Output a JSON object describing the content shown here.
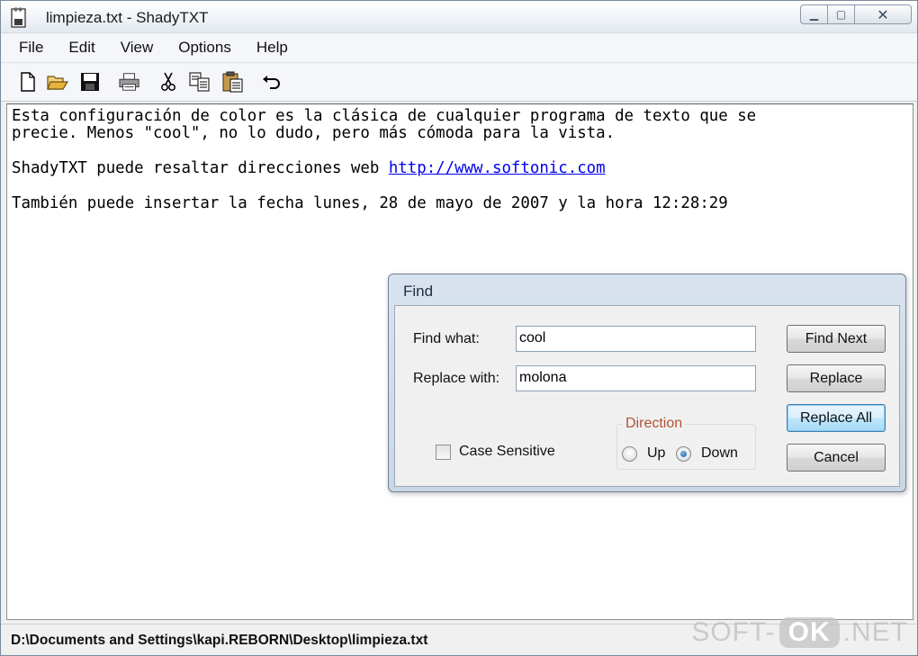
{
  "window": {
    "title": "limpieza.txt - ShadyTXT",
    "app_icon": "notepad-document-icon",
    "caption_buttons": [
      "minimize-icon",
      "maximize-icon",
      "close-icon"
    ],
    "minimize_glyph": "▁",
    "maximize_glyph": "▢",
    "close_glyph": "✕"
  },
  "menu": {
    "items": [
      "File",
      "Edit",
      "View",
      "Options",
      "Help"
    ]
  },
  "toolbar": {
    "icons": [
      "new-document-icon",
      "open-folder-icon",
      "save-icon",
      "print-icon",
      "cut-icon",
      "copy-icon",
      "paste-icon",
      "undo-icon"
    ]
  },
  "editor": {
    "line1": "Esta configuración de color es la clásica de cualquier programa de texto que se",
    "line2": "precie. Menos \"cool\", no lo dudo, pero más cómoda para la vista.",
    "line3_prefix": "ShadyTXT puede resaltar direcciones web ",
    "line3_link": "http://www.softonic.com",
    "line4": "También puede insertar la fecha lunes, 28 de mayo de 2007 y la hora 12:28:29"
  },
  "status": {
    "path": "D:\\Documents and Settings\\kapi.REBORN\\Desktop\\limpieza.txt",
    "watermark_left": "SOFT-",
    "watermark_mid": "OK",
    "watermark_right": ".NET"
  },
  "find_dialog": {
    "title": "Find",
    "find_label": "Find what:",
    "find_value": "cool",
    "replace_label": "Replace with:",
    "replace_value": "molona",
    "case_sensitive_label": "Case Sensitive",
    "case_sensitive_checked": false,
    "direction_label": "Direction",
    "direction_up": "Up",
    "direction_down": "Down",
    "direction_selected": "Down",
    "buttons": {
      "find_next": "Find Next",
      "replace": "Replace",
      "replace_all": "Replace All",
      "cancel": "Cancel"
    }
  },
  "colors": {
    "link": "#0000ee",
    "direction_legend": "#b05236"
  }
}
